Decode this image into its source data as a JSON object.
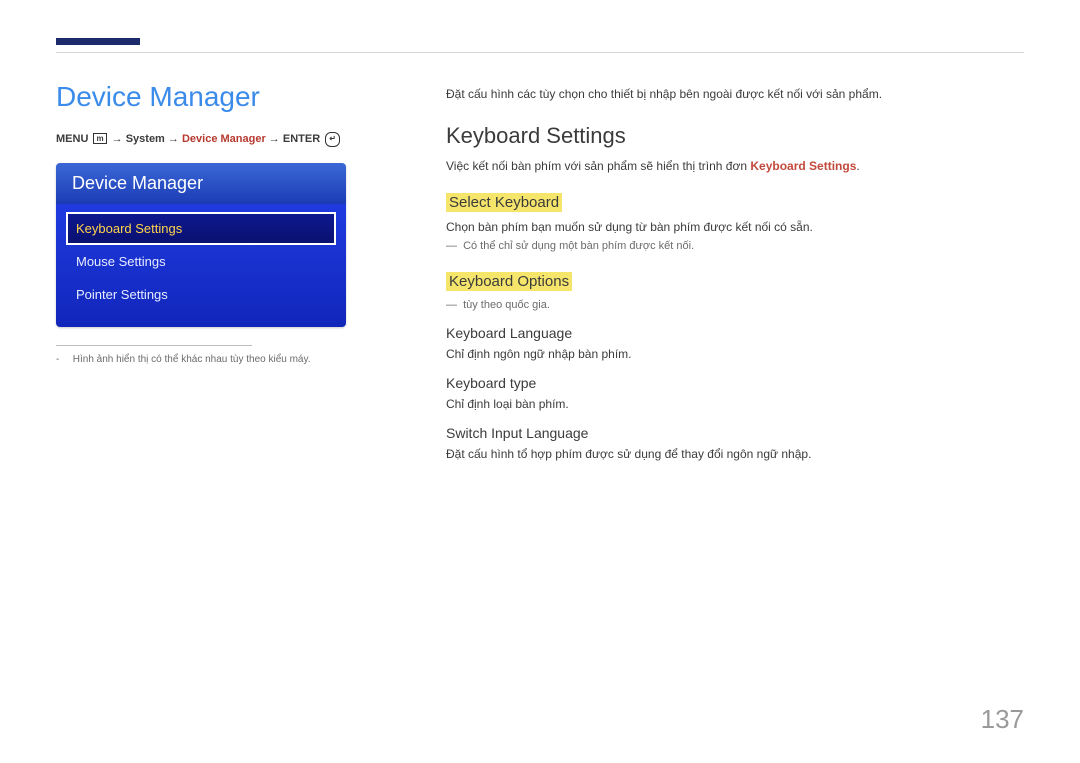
{
  "page_number": "137",
  "left": {
    "section_title": "Device Manager",
    "breadcrumb": {
      "menu": "MENU",
      "arrow": "→",
      "system": "System",
      "device_manager": "Device Manager",
      "enter": "ENTER"
    },
    "menu": {
      "title": "Device Manager",
      "items": [
        {
          "label": "Keyboard Settings",
          "selected": true
        },
        {
          "label": "Mouse Settings",
          "selected": false
        },
        {
          "label": "Pointer Settings",
          "selected": false
        }
      ]
    },
    "footnote_dash": "-",
    "footnote_text": "Hình ảnh hiển thị có thể khác nhau tùy theo kiểu máy."
  },
  "right": {
    "intro": "Đặt cấu hình các tùy chọn cho thiết bị nhập bên ngoài được kết nối với sản phẩm.",
    "h2": "Keyboard Settings",
    "p1_prefix": "Việc kết nối bàn phím với sản phẩm sẽ hiển thị trình đơn ",
    "p1_hl": "Keyboard Settings",
    "p1_suffix": ".",
    "select_keyboard": {
      "title": "Select Keyboard",
      "para": "Chọn bàn phím bạn muốn sử dụng từ bàn phím được kết nối có sẵn.",
      "note_dash": "―",
      "note": "Có thể chỉ sử dụng một bàn phím được kết nối."
    },
    "keyboard_options": {
      "title": "Keyboard Options",
      "note_dash": "―",
      "note": "tùy theo quốc gia.",
      "items": [
        {
          "title": "Keyboard Language",
          "desc": "Chỉ định ngôn ngữ nhập bàn phím."
        },
        {
          "title": "Keyboard type",
          "desc": "Chỉ định loại bàn phím."
        },
        {
          "title": "Switch Input Language",
          "desc": "Đặt cấu hình tổ hợp phím được sử dụng để thay đổi ngôn ngữ nhập."
        }
      ]
    }
  }
}
